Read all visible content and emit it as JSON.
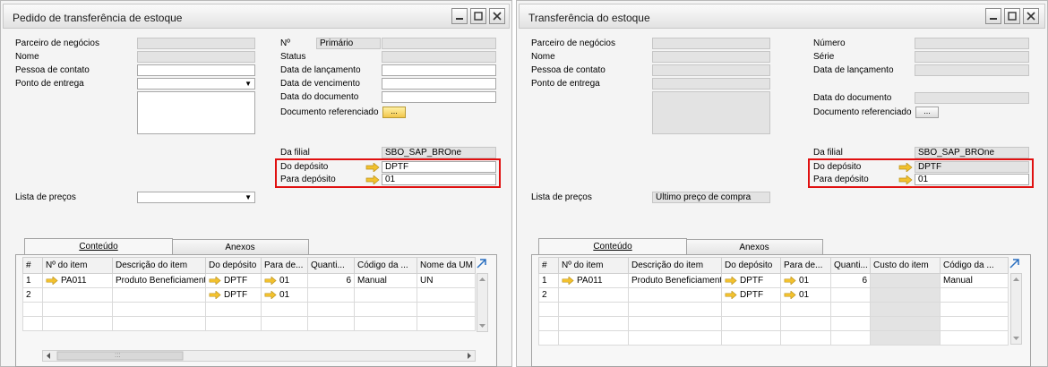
{
  "left": {
    "title": "Pedido de transferência de estoque",
    "labels": {
      "partner": "Parceiro de negócios",
      "name": "Nome",
      "contact": "Pessoa de contato",
      "delivery": "Ponto de entrega",
      "price_list": "Lista de preços",
      "no": "Nº",
      "status": "Status",
      "posting_date": "Data de lançamento",
      "due_date": "Data de vencimento",
      "doc_date": "Data do documento",
      "ref_doc": "Documento referenciado",
      "branch": "Da filial",
      "from_wh": "Do depósito",
      "to_wh": "Para depósito"
    },
    "values": {
      "series": "Primário",
      "ref_btn": "...",
      "branch": "SBO_SAP_BROne",
      "from_wh": "DPTF",
      "to_wh": "01"
    },
    "tabs": [
      "Conteúdo",
      "Anexos"
    ],
    "columns": [
      "#",
      "Nº do item",
      "Descrição do item",
      "Do depósito",
      "Para de...",
      "Quanti...",
      "Código da ...",
      "Nome da UM"
    ],
    "rows": [
      [
        "1",
        "PA011",
        "Produto Beneficiamento",
        "DPTF",
        "01",
        "6",
        "Manual",
        "UN"
      ],
      [
        "2",
        "",
        "",
        "DPTF",
        "01",
        "",
        "",
        ""
      ]
    ],
    "hscroll_grip": ":::"
  },
  "right": {
    "title": "Transferência do estoque",
    "labels": {
      "partner": "Parceiro de negócios",
      "name": "Nome",
      "contact": "Pessoa de contato",
      "delivery": "Ponto de entrega",
      "price_list": "Lista de preços",
      "number": "Número",
      "series": "Série",
      "posting_date": "Data de lançamento",
      "doc_date": "Data do documento",
      "ref_doc": "Documento referenciado",
      "branch": "Da filial",
      "from_wh": "Do depósito",
      "to_wh": "Para depósito"
    },
    "values": {
      "price_list": "Último preço de compra",
      "ref_btn": "...",
      "branch": "SBO_SAP_BROne",
      "from_wh": "DPTF",
      "to_wh": "01"
    },
    "tabs": [
      "Conteúdo",
      "Anexos"
    ],
    "columns": [
      "#",
      "Nº do item",
      "Descrição do item",
      "Do depósito",
      "Para de...",
      "Quanti...",
      "Custo do item",
      "Código da ..."
    ],
    "rows": [
      [
        "1",
        "PA011",
        "Produto Beneficiamento",
        "DPTF",
        "01",
        "6",
        "",
        "Manual"
      ],
      [
        "2",
        "",
        "",
        "DPTF",
        "01",
        "",
        "",
        ""
      ]
    ]
  },
  "colors": {
    "highlight": "#e01010",
    "arrow": "#f2c12e"
  }
}
